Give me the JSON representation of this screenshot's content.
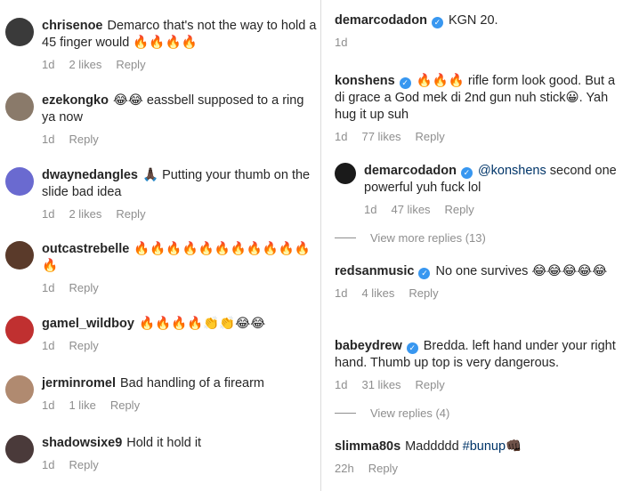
{
  "left": [
    {
      "user": "chrisenoe",
      "text": "Demarco that's not the way to hold a 45 finger would 🔥🔥🔥🔥",
      "time": "1d",
      "likes": "2 likes",
      "reply": "Reply",
      "avatar_color": "#3a3a3a"
    },
    {
      "user": "ezekongko",
      "text": "😂😂 eassbell supposed to a ring ya now",
      "time": "1d",
      "likes": "",
      "reply": "Reply",
      "avatar_color": "#8a7a6a"
    },
    {
      "user": "dwaynedangles",
      "text": "🙏🏿 Putting your thumb on the slide bad idea",
      "time": "1d",
      "likes": "2 likes",
      "reply": "Reply",
      "avatar_color": "#6a6ad0"
    },
    {
      "user": "outcastrebelle",
      "text": "🔥🔥🔥🔥🔥🔥🔥🔥🔥🔥🔥🔥",
      "time": "1d",
      "likes": "",
      "reply": "Reply",
      "avatar_color": "#5a3a2a"
    },
    {
      "user": "gamel_wildboy",
      "text": "🔥🔥🔥🔥👏👏😂😂",
      "time": "1d",
      "likes": "",
      "reply": "Reply",
      "avatar_color": "#c03030"
    },
    {
      "user": "jerminromel",
      "text": "Bad handling of a firearm",
      "time": "1d",
      "likes": "1 like",
      "reply": "Reply",
      "avatar_color": "#b08a70"
    },
    {
      "user": "shadowsixe9",
      "text": "Hold it hold it",
      "time": "1d",
      "likes": "",
      "reply": "Reply",
      "avatar_color": "#4a3a3a"
    }
  ],
  "right": {
    "top": {
      "user": "demarcodadon",
      "text": "KGN 20.",
      "time": "1d"
    },
    "konshens": {
      "user": "konshens",
      "text": "🔥🔥🔥 rifle form look good. But a di grace a God mek di 2nd gun nuh stick😀. Yah hug it up suh",
      "time": "1d",
      "likes": "77 likes",
      "reply": "Reply"
    },
    "reply1": {
      "user": "demarcodadon",
      "mention": "@konshens",
      "text": " second one powerful yuh fuck lol",
      "time": "1d",
      "likes": "47 likes",
      "reply": "Reply",
      "avatar_color": "#1a1a1a"
    },
    "view_more_1": "View more replies (13)",
    "redsan": {
      "user": "redsanmusic",
      "text": "No one survives 😂😂😂😂😂",
      "time": "1d",
      "likes": "4 likes",
      "reply": "Reply"
    },
    "babey": {
      "user": "babeydrew",
      "text": "Bredda. left hand under your right hand. Thumb up top is very dangerous.",
      "time": "1d",
      "likes": "31 likes",
      "reply": "Reply"
    },
    "view_more_2": "View replies (4)",
    "slimma": {
      "user": "slimma80s",
      "text": "Maddddd ",
      "hashtag": "#bunup",
      "emoji": "👊🏿",
      "time": "22h",
      "reply": "Reply"
    }
  },
  "colors": {
    "verified": "#3897f0",
    "meta": "#8e8e8e",
    "link": "#003569"
  }
}
